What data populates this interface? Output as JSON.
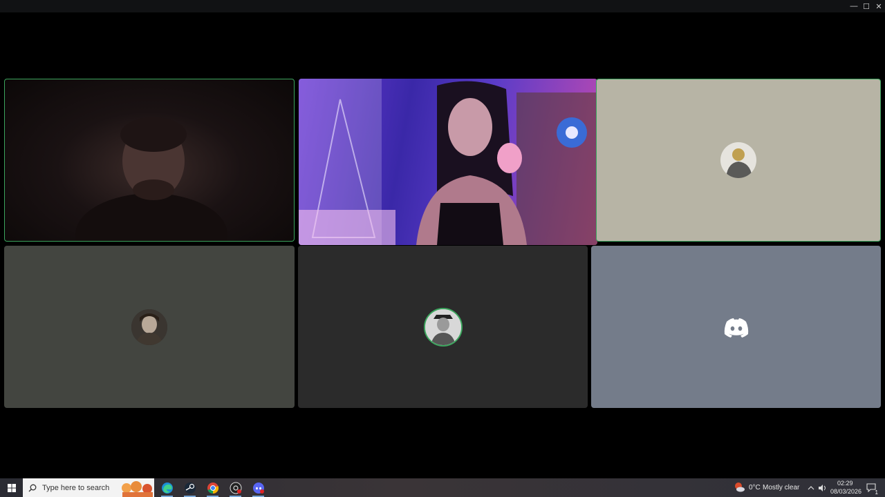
{
  "window": {
    "controls": {
      "minimize": "—",
      "maximize": "☐",
      "close": "✕"
    }
  },
  "tiles": [
    {
      "id": "user-1",
      "type": "video",
      "speaking": true,
      "avatar_icon": "person-icon"
    },
    {
      "id": "user-2",
      "type": "video",
      "speaking": false,
      "avatar_icon": "person-icon"
    },
    {
      "id": "user-3",
      "type": "avatar",
      "speaking": true,
      "background": "#b7b4a5",
      "avatar_icon": "person-icon"
    },
    {
      "id": "user-4",
      "type": "avatar",
      "speaking": false,
      "background": "#434540",
      "avatar_icon": "person-icon"
    },
    {
      "id": "user-5",
      "type": "avatar",
      "speaking": false,
      "background": "#2b2b2b",
      "avatar_icon": "person-icon"
    },
    {
      "id": "user-6",
      "type": "avatar",
      "speaking": false,
      "background": "#747c8a",
      "avatar_icon": "discord-logo-icon"
    }
  ],
  "taskbar": {
    "start_icon": "windows-start-icon",
    "search_placeholder": "Type here to search",
    "pinned": [
      "edge-icon",
      "steam-icon",
      "chrome-icon",
      "obs-icon",
      "discord-icon"
    ],
    "weather": {
      "temperature": "0°C",
      "condition": "Mostly clear"
    },
    "clock": {
      "time": "02:29",
      "date": "08/03/2026"
    },
    "notifications_count": "1"
  }
}
